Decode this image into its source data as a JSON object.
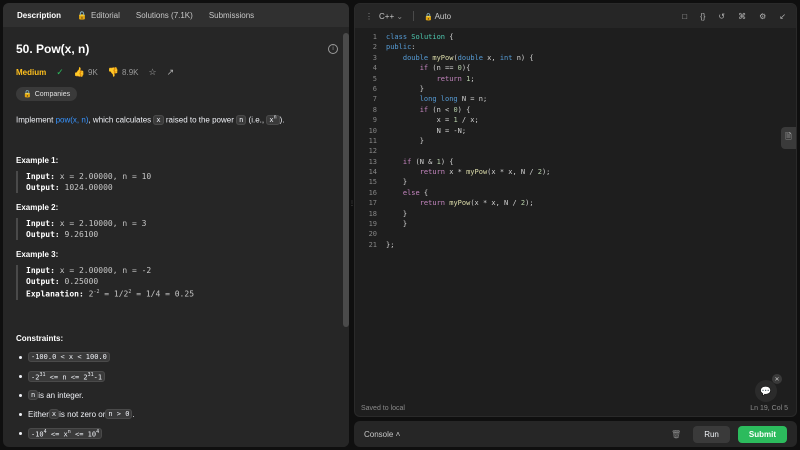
{
  "tabs": [
    {
      "label": "Description",
      "active": true
    },
    {
      "label": "Editorial",
      "icon": "lock-icon"
    },
    {
      "label": "Solutions (7.1K)"
    },
    {
      "label": "Submissions"
    }
  ],
  "problem": {
    "title": "50. Pow(x, n)",
    "difficulty": "Medium",
    "likes": "9K",
    "dislikes": "8.9K",
    "companies_label": "Companies",
    "desc_prefix": "Implement ",
    "desc_link": "pow(x, n)",
    "desc_mid": ", which calculates ",
    "desc_x": "x",
    "desc_mid2": " raised to the power ",
    "desc_n": "n",
    "desc_ie": " (i.e., ",
    "desc_xn_base": "x",
    "desc_xn_exp": "n",
    "desc_end": ")."
  },
  "examples": [
    {
      "title": "Example 1:",
      "input_label": "Input:",
      "input": " x = 2.00000, n = 10",
      "output_label": "Output:",
      "output": " 1024.00000"
    },
    {
      "title": "Example 2:",
      "input_label": "Input:",
      "input": " x = 2.10000, n = 3",
      "output_label": "Output:",
      "output": " 9.26100"
    },
    {
      "title": "Example 3:",
      "input_label": "Input:",
      "input": " x = 2.00000, n = -2",
      "output_label": "Output:",
      "output": " 0.25000",
      "explanation_label": "Explanation:",
      "explanation_pre": " 2",
      "explanation_exp": "-2",
      "explanation_mid": " = 1/2",
      "explanation_exp2": "2",
      "explanation_post": " = 1/4 = 0.25"
    }
  ],
  "constraints": {
    "title": "Constraints:",
    "c1": "-100.0 < x < 100.0",
    "c2_a": "-2",
    "c2_a_exp": "31",
    "c2_b": " <= n <= 2",
    "c2_b_exp": "31",
    "c2_c": "-1",
    "c3_code": "n",
    "c3_text": " is an integer.",
    "c4_a": "Either ",
    "c4_code1": "x",
    "c4_b": " is not zero or ",
    "c4_code2": "n > 0",
    "c4_c": ".",
    "c5_a": "-10",
    "c5_a_exp": "4",
    "c5_b": " <= x",
    "c5_b_exp": "n",
    "c5_c": " <= 10",
    "c5_c_exp": "4"
  },
  "editor": {
    "language": "C++",
    "mode": "Auto",
    "status_left": "Saved to local",
    "status_right": "Ln 19, Col 5",
    "line_numbers": [
      "1",
      "2",
      "3",
      "4",
      "5",
      "6",
      "7",
      "8",
      "9",
      "10",
      "11",
      "12",
      "13",
      "14",
      "15",
      "16",
      "17",
      "18",
      "19",
      "20",
      "21"
    ]
  },
  "console": {
    "label": "Console",
    "run": "Run",
    "submit": "Submit"
  }
}
